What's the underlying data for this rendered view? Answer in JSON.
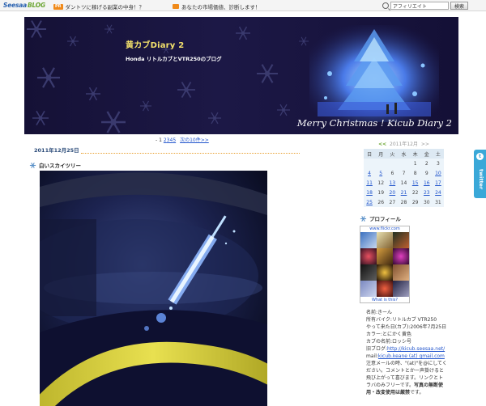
{
  "topbar": {
    "logo_main": "Seesaa",
    "logo_sub": "BLOG",
    "promo1_tag": "PR",
    "promo1_text": "ダントツに稼げる副業の中身！？",
    "promo2_text": "あなたの市場価値、診断します！",
    "search_value": "アフィリエイト",
    "search_button": "検索"
  },
  "banner": {
    "title": "黄カブDiary 2",
    "subtitle": "Honda リトルカブとVTR250のブログ",
    "caption": "Merry Christmas ! Kicub Diary 2"
  },
  "pager": {
    "dash": "- ",
    "current": "1",
    "pages": [
      "2",
      "3",
      "4",
      "5"
    ],
    "next": "次の10件>>"
  },
  "post": {
    "date": "2011年12月25日",
    "title": "白いスカイツリー"
  },
  "calendar": {
    "prev": "<<",
    "month": "2011年12月",
    "next": ">>",
    "weekdays": [
      "日",
      "月",
      "火",
      "水",
      "木",
      "金",
      "土"
    ],
    "weeks": [
      [
        "",
        "",
        "",
        "",
        "1",
        "2",
        "3"
      ],
      [
        "4",
        "5",
        "6",
        "7",
        "8",
        "9",
        "10"
      ],
      [
        "11",
        "12",
        "13",
        "14",
        "15",
        "16",
        "17"
      ],
      [
        "18",
        "19",
        "20",
        "21",
        "22",
        "23",
        "24"
      ],
      [
        "25",
        "26",
        "27",
        "28",
        "29",
        "30",
        "31"
      ]
    ],
    "linked_days": [
      "4",
      "5",
      "10",
      "11",
      "13",
      "15",
      "16",
      "17",
      "18",
      "20",
      "21",
      "23",
      "24",
      "25"
    ]
  },
  "profile": {
    "heading": "プロフィール",
    "flickr_top": "www.flickr.com",
    "flickr_bottom": "What is this?",
    "name_line": "名前:きーん",
    "bike_line": "所有バイク:リトルカブ VTR250",
    "came_line": "やって来た日(カブ):2006年7月25日",
    "color_line": "カラー:とにかく黄色",
    "cub_name_line": "カブの名前:ロッシ号",
    "old_blog_label": "旧ブログ:",
    "old_blog_link": "http://kicub.seesaa.net/",
    "mail_label": "mail:",
    "mail_link": "kicub.keane (at) gmail.com",
    "note1": "注意メールの時、\"(at)\"を@にしてください。コメントとか一声掛けると飛び上がって喜びます。リンクとトラバのみフリーです。",
    "note_strong": "写真の無断使用・改変使用は厳禁",
    "note_end": "です。"
  },
  "twitter": {
    "word": "twitter",
    "icon": "t"
  }
}
